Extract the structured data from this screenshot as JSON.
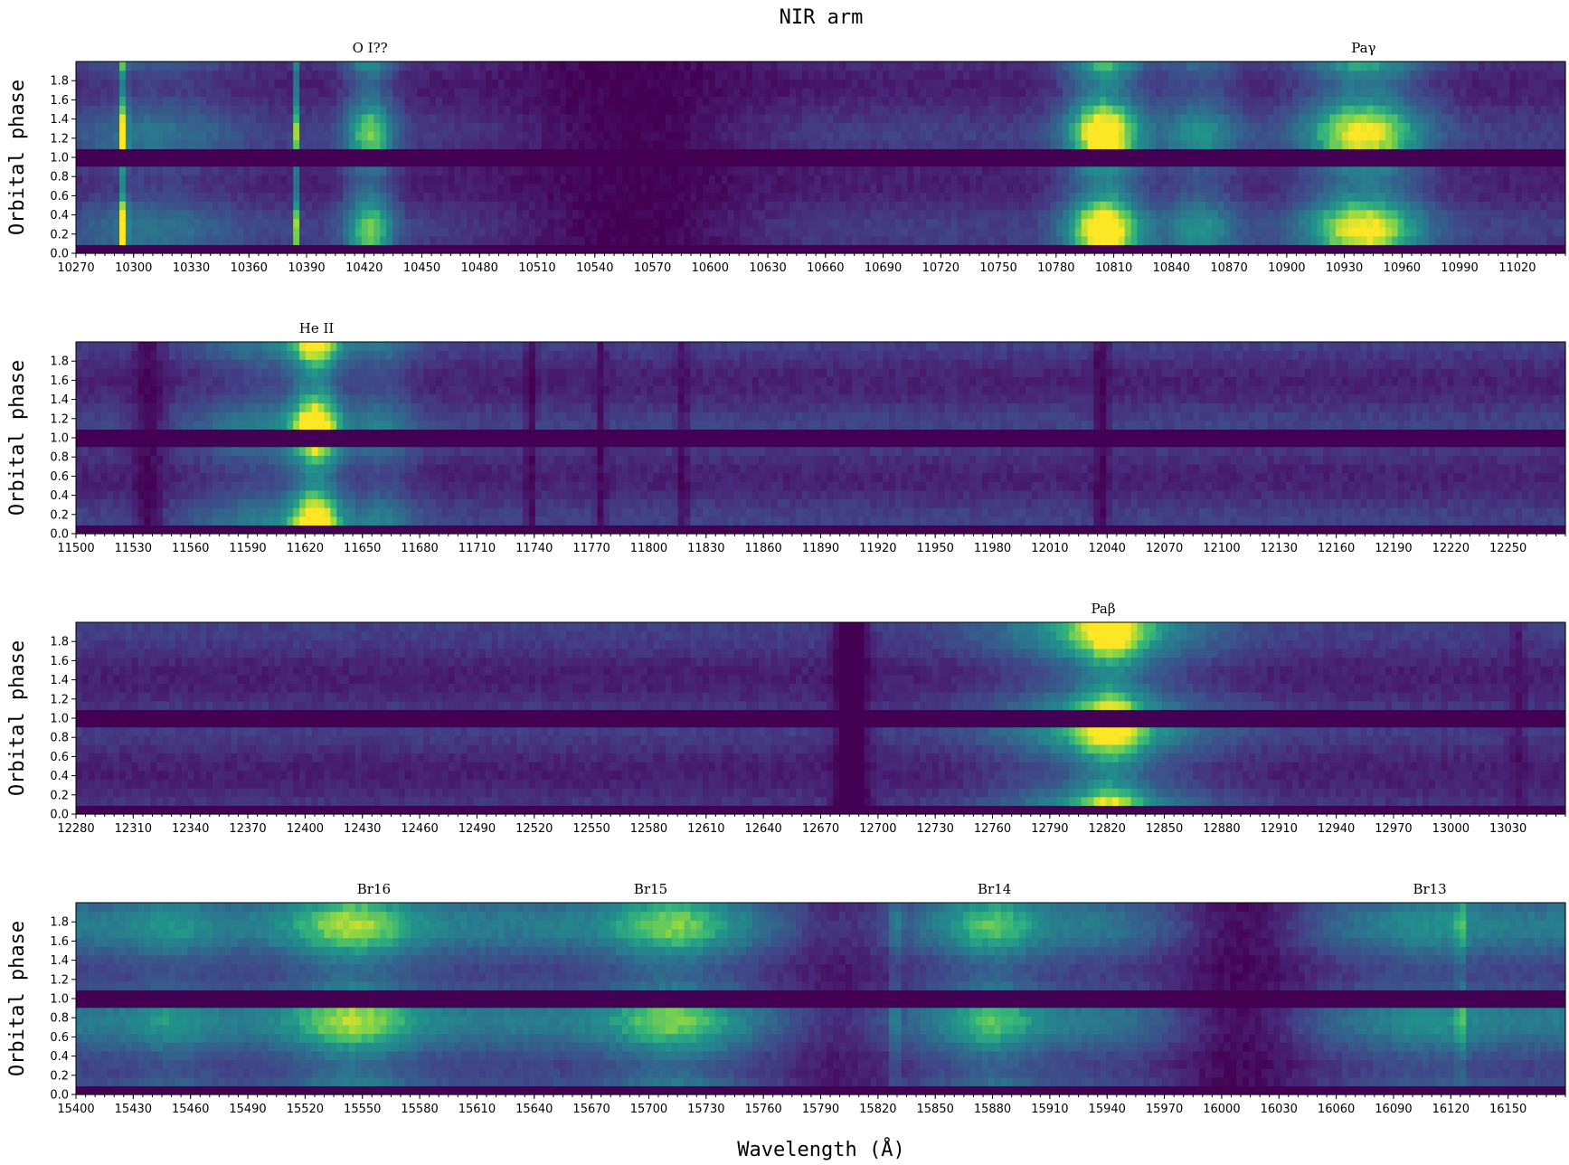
{
  "figure": {
    "title": "NIR arm",
    "xlabel": "Wavelength (Å)",
    "colors": {
      "low": "#440154",
      "mid": "#21918c",
      "high": "#fde725",
      "gap": "#440154"
    }
  },
  "chart_data": [
    {
      "type": "heatmap",
      "panel": 1,
      "ylabel": "Orbital phase",
      "xlim": [
        10270,
        11045
      ],
      "ylim": [
        0.0,
        2.0
      ],
      "x_ticks": [
        10270,
        10300,
        10330,
        10360,
        10390,
        10420,
        10450,
        10480,
        10510,
        10540,
        10570,
        10600,
        10630,
        10660,
        10690,
        10720,
        10750,
        10780,
        10810,
        10840,
        10870,
        10900,
        10930,
        10960,
        10990,
        11020
      ],
      "y_ticks": [
        0.0,
        0.2,
        0.4,
        0.6,
        0.8,
        1.0,
        1.2,
        1.4,
        1.6,
        1.8
      ],
      "phase_gap": 1.0,
      "line_labels": [
        {
          "text": "O I??",
          "wavelength": 10423
        },
        {
          "text": "Paγ",
          "wavelength": 10940
        }
      ],
      "profile": {
        "base": 0.2,
        "features": [
          {
            "center": 10295,
            "width": 1.2,
            "amp": 0.75
          },
          {
            "center": 10310,
            "width": 30,
            "amp": 0.22
          },
          {
            "center": 10385,
            "width": 1.0,
            "amp": 0.6
          },
          {
            "center": 10423,
            "width": 9,
            "amp": 0.55
          },
          {
            "center": 10560,
            "width": 45,
            "amp": -0.2
          },
          {
            "center": 10805,
            "width": 14,
            "amp": 0.8
          },
          {
            "center": 10855,
            "width": 14,
            "amp": 0.35
          },
          {
            "center": 10940,
            "width": 22,
            "amp": 0.7
          }
        ]
      }
    },
    {
      "type": "heatmap",
      "panel": 2,
      "ylabel": "Orbital phase",
      "xlim": [
        11500,
        12280
      ],
      "ylim": [
        0.0,
        2.0
      ],
      "x_ticks": [
        11500,
        11530,
        11560,
        11590,
        11620,
        11650,
        11680,
        11710,
        11740,
        11770,
        11800,
        11830,
        11860,
        11890,
        11920,
        11950,
        11980,
        12010,
        12040,
        12070,
        12100,
        12130,
        12160,
        12190,
        12220,
        12250
      ],
      "y_ticks": [
        0.0,
        0.2,
        0.4,
        0.6,
        0.8,
        1.0,
        1.2,
        1.4,
        1.6,
        1.8
      ],
      "phase_gap": 1.0,
      "line_labels": [
        {
          "text": "He II",
          "wavelength": 11626
        }
      ],
      "profile": {
        "base": 0.22,
        "features": [
          {
            "center": 11538,
            "width": 6,
            "amp": -0.2
          },
          {
            "center": 11600,
            "width": 25,
            "amp": 0.25
          },
          {
            "center": 11626,
            "width": 9,
            "amp": 0.7
          },
          {
            "center": 11660,
            "width": 12,
            "amp": 0.25
          },
          {
            "center": 11738,
            "width": 2,
            "amp": -0.2
          },
          {
            "center": 11775,
            "width": 2,
            "amp": -0.18
          },
          {
            "center": 11818,
            "width": 2,
            "amp": -0.18
          },
          {
            "center": 12037,
            "width": 3,
            "amp": -0.2
          }
        ]
      }
    },
    {
      "type": "heatmap",
      "panel": 3,
      "ylabel": "Orbital phase",
      "xlim": [
        12280,
        13060
      ],
      "ylim": [
        0.0,
        2.0
      ],
      "x_ticks": [
        12280,
        12310,
        12340,
        12370,
        12400,
        12430,
        12460,
        12490,
        12520,
        12550,
        12580,
        12610,
        12640,
        12670,
        12700,
        12730,
        12760,
        12790,
        12820,
        12850,
        12880,
        12910,
        12940,
        12970,
        13000,
        13030
      ],
      "y_ticks": [
        0.0,
        0.2,
        0.4,
        0.6,
        0.8,
        1.0,
        1.2,
        1.4,
        1.6,
        1.8
      ],
      "phase_gap": 1.0,
      "line_labels": [
        {
          "text": "Paβ",
          "wavelength": 12818
        }
      ],
      "profile": {
        "base": 0.2,
        "features": [
          {
            "center": 12686,
            "width": 6,
            "amp": -0.35
          },
          {
            "center": 12818,
            "width": 38,
            "amp": 0.45
          },
          {
            "center": 12822,
            "width": 12,
            "amp": 0.4
          },
          {
            "center": 13035,
            "width": 3,
            "amp": -0.12
          }
        ]
      }
    },
    {
      "type": "heatmap",
      "panel": 4,
      "ylabel": "Orbital phase",
      "xlim": [
        15400,
        16180
      ],
      "ylim": [
        0.0,
        2.0
      ],
      "x_ticks": [
        15400,
        15430,
        15460,
        15490,
        15520,
        15550,
        15580,
        15610,
        15640,
        15670,
        15700,
        15730,
        15760,
        15790,
        15820,
        15850,
        15880,
        15910,
        15940,
        15970,
        16000,
        16030,
        16060,
        16090,
        16120,
        16150
      ],
      "y_ticks": [
        0.0,
        0.2,
        0.4,
        0.6,
        0.8,
        1.0,
        1.2,
        1.4,
        1.6,
        1.8
      ],
      "phase_gap": 1.0,
      "line_labels": [
        {
          "text": "Br16",
          "wavelength": 15556
        },
        {
          "text": "Br15",
          "wavelength": 15701
        },
        {
          "text": "Br14",
          "wavelength": 15881
        },
        {
          "text": "Br13",
          "wavelength": 16109
        }
      ],
      "profile": {
        "base": 0.45,
        "features": [
          {
            "center": 15450,
            "width": 14,
            "amp": 0.12
          },
          {
            "center": 15545,
            "width": 22,
            "amp": 0.35
          },
          {
            "center": 15712,
            "width": 22,
            "amp": 0.3
          },
          {
            "center": 15800,
            "width": 25,
            "amp": -0.3
          },
          {
            "center": 15880,
            "width": 16,
            "amp": 0.25
          },
          {
            "center": 16010,
            "width": 30,
            "amp": -0.4
          },
          {
            "center": 16110,
            "width": 18,
            "amp": 0.1
          },
          {
            "center": 15829,
            "width": 1.2,
            "amp": 0.35
          },
          {
            "center": 16125,
            "width": 1.2,
            "amp": 0.35
          }
        ]
      }
    }
  ]
}
